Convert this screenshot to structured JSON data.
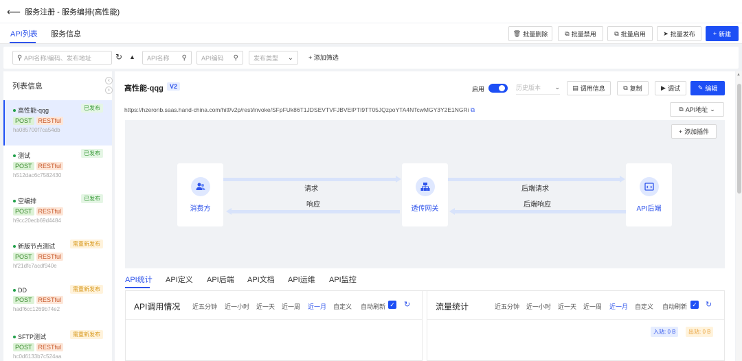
{
  "header": {
    "title": "服务注册 - 服务编排(高性能)"
  },
  "tabs": [
    "API列表",
    "服务信息"
  ],
  "toolbar": {
    "batch_delete": "批量删除",
    "batch_disable": "批量禁用",
    "batch_enable": "批量启用",
    "batch_publish": "批量发布",
    "create": "新建"
  },
  "filters": {
    "search_placeholder": "API名称/编码、发布地址",
    "api_name": "API名称",
    "api_code": "API编码",
    "publish_type": "发布类型",
    "add_filter": "添加筛选"
  },
  "sidebar": {
    "title": "列表信息",
    "items": [
      {
        "name": "高性能-qqg",
        "status": "已发布",
        "status_type": "published",
        "method": "POST",
        "type": "RESTful",
        "id": "ha085700f7ca54db",
        "active": true
      },
      {
        "name": "测试",
        "status": "已发布",
        "status_type": "published",
        "method": "POST",
        "type": "RESTful",
        "id": "h512dac6c7582430"
      },
      {
        "name": "空编排",
        "status": "已发布",
        "status_type": "published",
        "method": "POST",
        "type": "RESTful",
        "id": "h9cc20ecb69d4484"
      },
      {
        "name": "新版节点测试",
        "status": "需重新发布",
        "status_type": "needs-republish",
        "method": "POST",
        "type": "RESTful",
        "id": "hf21dfc7acdf940e"
      },
      {
        "name": "DD",
        "status": "需重新发布",
        "status_type": "needs-republish",
        "method": "POST",
        "type": "RESTful",
        "id": "hadf6cc1269b74e2"
      },
      {
        "name": "SFTP测试",
        "status": "需重新发布",
        "status_type": "needs-republish",
        "method": "POST",
        "type": "RESTful",
        "id": "hc0d6133b7c524aa"
      }
    ]
  },
  "detail": {
    "name": "高性能-qqg",
    "version": "V2",
    "enable_label": "启用",
    "enabled": true,
    "history_placeholder": "历史版本",
    "call_info": "调用信息",
    "copy": "复制",
    "debug": "调试",
    "edit": "编辑",
    "url": "https://hzeronb.saas.hand-china.com/hitf/v2p/rest/invoke/SFpFUk86T1JDSEVTVFJBVElPTI9TT05JQzpoYTA4NTcwMGY3Y2E1NGRi",
    "api_address": "API地址",
    "add_plugin": "添加插件"
  },
  "diagram": {
    "consumer": "消费方",
    "gateway": "透传网关",
    "backend": "API后端",
    "request": "请求",
    "response": "响应",
    "backend_request": "后端请求",
    "backend_response": "后端响应"
  },
  "subtabs": [
    "API统计",
    "API定义",
    "API后端",
    "API文档",
    "API运维",
    "API监控"
  ],
  "stats": {
    "calls_title": "API调用情况",
    "traffic_title": "流量统计",
    "ranges": [
      "近五分钟",
      "近一小时",
      "近一天",
      "近一周",
      "近一月",
      "自定义"
    ],
    "active_range": "近一月",
    "auto_refresh": "自动刷新",
    "inbound": "入站: 0 B",
    "outbound": "出站: 0 B"
  },
  "colors": {
    "primary": "#1d4ff5",
    "published": "#3a9a3a",
    "needs_republish": "#d89a1f"
  }
}
